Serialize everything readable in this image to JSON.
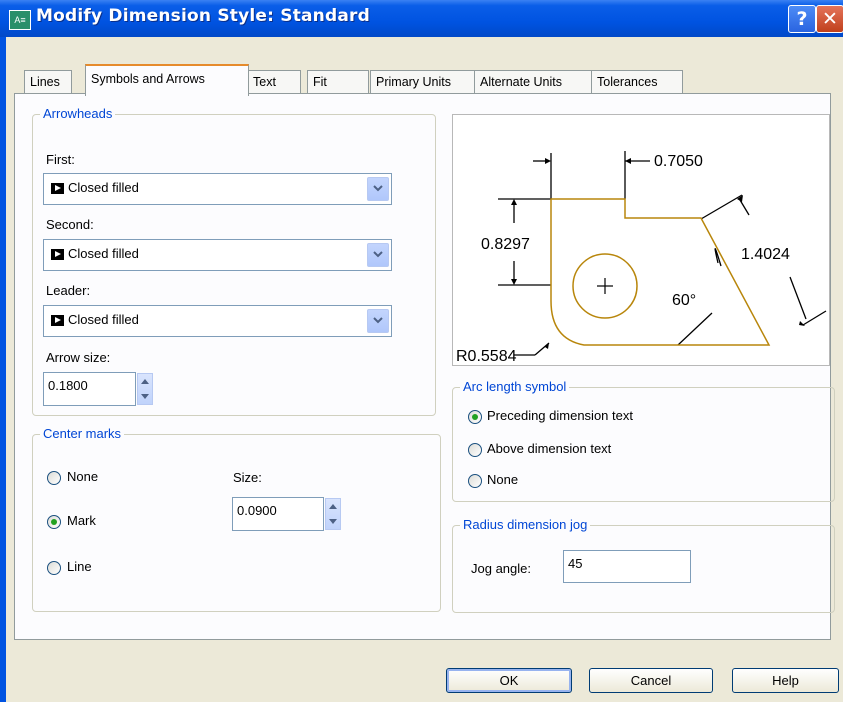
{
  "window": {
    "title": "Modify Dimension Style: Standard",
    "app_icon": "autocad-dim-icon",
    "help_label": "?",
    "close_label": "✕"
  },
  "tabs": [
    {
      "label": "Lines"
    },
    {
      "label": "Symbols and Arrows"
    },
    {
      "label": "Text"
    },
    {
      "label": "Fit"
    },
    {
      "label": "Primary Units"
    },
    {
      "label": "Alternate Units"
    },
    {
      "label": "Tolerances"
    }
  ],
  "arrowheads": {
    "legend": "Arrowheads",
    "first_label": "First:",
    "first_value": "Closed filled",
    "second_label": "Second:",
    "second_value": "Closed filled",
    "leader_label": "Leader:",
    "leader_value": "Closed filled",
    "size_label": "Arrow size:",
    "size_value": "0.1800"
  },
  "center_marks": {
    "legend": "Center marks",
    "options": [
      {
        "label": "None",
        "selected": false
      },
      {
        "label": "Mark",
        "selected": true
      },
      {
        "label": "Line",
        "selected": false
      }
    ],
    "size_label": "Size:",
    "size_value": "0.0900"
  },
  "preview": {
    "dims": {
      "top": "0.7050",
      "left": "0.8297",
      "right": "1.4024",
      "angle": "60°",
      "radius": "R0.5584"
    },
    "center_mark": "+",
    "geometry_color": "#b8860b"
  },
  "arc_length_symbol": {
    "legend": "Arc length symbol",
    "options": [
      {
        "label": "Preceding dimension text",
        "selected": true
      },
      {
        "label": "Above dimension text",
        "selected": false
      },
      {
        "label": "None",
        "selected": false
      }
    ]
  },
  "radius_jog": {
    "legend": "Radius dimension jog",
    "jog_label": "Jog angle:",
    "jog_value": "45"
  },
  "footer": {
    "ok": "OK",
    "cancel": "Cancel",
    "help": "Help"
  },
  "colors": {
    "title_bar": "#0053e1",
    "group_label": "#0046d5",
    "active_tab_accent": "#e68b2c",
    "radio_dot": "#21a121"
  }
}
